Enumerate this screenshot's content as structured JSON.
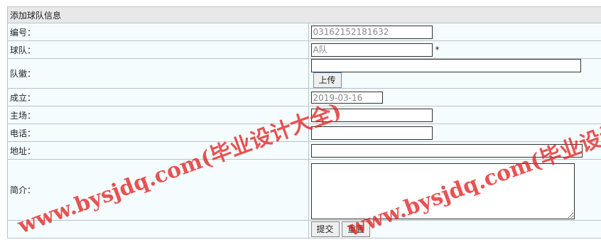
{
  "form": {
    "title": "添加球队信息",
    "fields": {
      "number": {
        "label": "编号：",
        "value": "03162152181632"
      },
      "team": {
        "label": "球队：",
        "value": "A队",
        "required_mark": "*"
      },
      "emblem": {
        "label": "队徽：",
        "value": "",
        "upload_label": "上传"
      },
      "founded": {
        "label": "成立：",
        "value": "2019-03-16"
      },
      "home": {
        "label": "主场：",
        "value": ""
      },
      "phone": {
        "label": "电话：",
        "value": ""
      },
      "address": {
        "label": "地址：",
        "value": ""
      },
      "intro": {
        "label": "简介：",
        "value": ""
      }
    },
    "submit_label": "提交",
    "reset_label": "重置"
  },
  "watermarks": [
    "www.bysjdq.com(毕业设计大全)",
    "www.bysjdq.com(毕业设计大全)"
  ],
  "colors": {
    "cell_bg": "#f4fcfd",
    "header_bg": "#e8e8e8",
    "border": "#b9c4c9",
    "watermark": "#e12323"
  }
}
